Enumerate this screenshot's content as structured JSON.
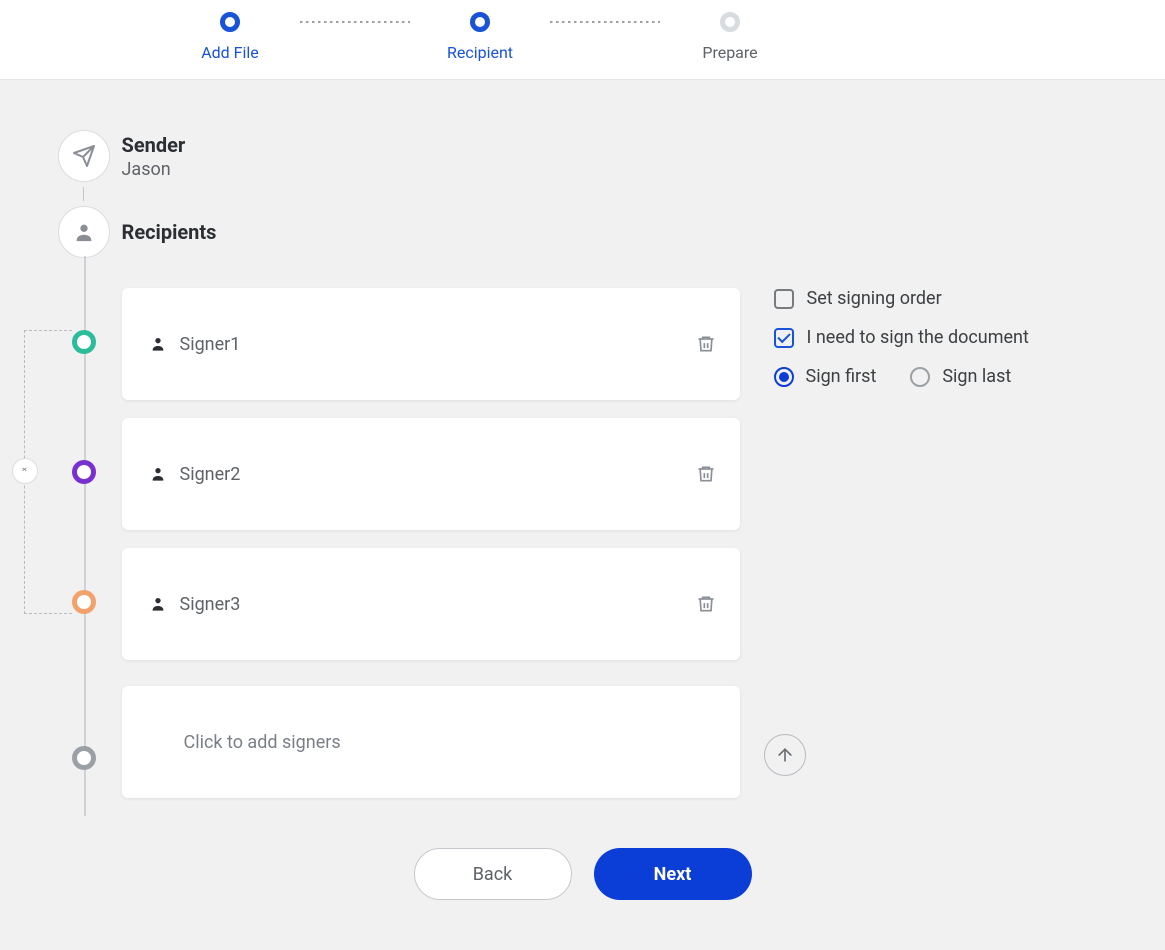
{
  "stepper": {
    "steps": [
      {
        "label": "Add File",
        "state": "done"
      },
      {
        "label": "Recipient",
        "state": "active"
      },
      {
        "label": "Prepare",
        "state": "future"
      }
    ]
  },
  "sender": {
    "heading": "Sender",
    "name": "Jason"
  },
  "recipients": {
    "heading": "Recipients",
    "group_count": "3",
    "signers": [
      {
        "name": "Signer1",
        "color": "#2bbd9a"
      },
      {
        "name": "Signer2",
        "color": "#7a2fd0"
      },
      {
        "name": "Signer3",
        "color": "#f4a26c"
      }
    ],
    "add_placeholder": "Click to add signers"
  },
  "options": {
    "set_order_label": "Set signing order",
    "set_order_checked": false,
    "need_sign_label": "I need to sign the document",
    "need_sign_checked": true,
    "sign_first_label": "Sign first",
    "sign_last_label": "Sign last",
    "sign_position": "first"
  },
  "footer": {
    "back_label": "Back",
    "next_label": "Next"
  },
  "icons": {
    "plane": "plane-icon",
    "user": "user-icon",
    "trash": "trash-icon",
    "arrow_up": "arrow-up-icon",
    "chevrons": "expand-collapse-icon"
  }
}
